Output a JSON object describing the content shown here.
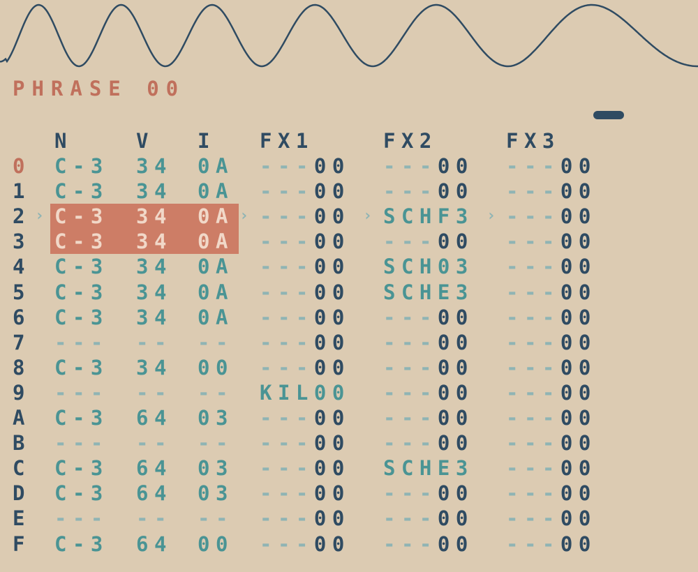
{
  "phrase": {
    "title": "PHRASE 00"
  },
  "columns": {
    "note": "N",
    "vel": "V",
    "inst": "I",
    "fx1": "FX1",
    "fx2": "FX2",
    "fx3": "FX3"
  },
  "colors": {
    "background": "#dccbb2",
    "accent": "#c0705c",
    "note": "#4a9494",
    "ink": "#2f4b62",
    "selection": "#cd7d66"
  },
  "rows": [
    {
      "num": "0",
      "note": "C-3",
      "vel": "34",
      "inst": "0A",
      "fx1": "---00",
      "fx2": "---00",
      "fx3": "---00"
    },
    {
      "num": "1",
      "note": "C-3",
      "vel": "34",
      "inst": "0A",
      "fx1": "---00",
      "fx2": "---00",
      "fx3": "---00"
    },
    {
      "num": "2",
      "note": "C-3",
      "vel": "34",
      "inst": "0A",
      "fx1": "---00",
      "fx2": "SCHF3",
      "fx3": "---00"
    },
    {
      "num": "3",
      "note": "C-3",
      "vel": "34",
      "inst": "0A",
      "fx1": "---00",
      "fx2": "---00",
      "fx3": "---00"
    },
    {
      "num": "4",
      "note": "C-3",
      "vel": "34",
      "inst": "0A",
      "fx1": "---00",
      "fx2": "SCH03",
      "fx3": "---00"
    },
    {
      "num": "5",
      "note": "C-3",
      "vel": "34",
      "inst": "0A",
      "fx1": "---00",
      "fx2": "SCHE3",
      "fx3": "---00"
    },
    {
      "num": "6",
      "note": "C-3",
      "vel": "34",
      "inst": "0A",
      "fx1": "---00",
      "fx2": "---00",
      "fx3": "---00"
    },
    {
      "num": "7",
      "note": "---",
      "vel": "--",
      "inst": "--",
      "fx1": "---00",
      "fx2": "---00",
      "fx3": "---00"
    },
    {
      "num": "8",
      "note": "C-3",
      "vel": "34",
      "inst": "00",
      "fx1": "---00",
      "fx2": "---00",
      "fx3": "---00"
    },
    {
      "num": "9",
      "note": "---",
      "vel": "--",
      "inst": "--",
      "fx1": "KIL00",
      "fx2": "---00",
      "fx3": "---00"
    },
    {
      "num": "A",
      "note": "C-3",
      "vel": "64",
      "inst": "03",
      "fx1": "---00",
      "fx2": "---00",
      "fx3": "---00"
    },
    {
      "num": "B",
      "note": "---",
      "vel": "--",
      "inst": "--",
      "fx1": "---00",
      "fx2": "---00",
      "fx3": "---00"
    },
    {
      "num": "C",
      "note": "C-3",
      "vel": "64",
      "inst": "03",
      "fx1": "---00",
      "fx2": "SCHE3",
      "fx3": "---00"
    },
    {
      "num": "D",
      "note": "C-3",
      "vel": "64",
      "inst": "03",
      "fx1": "---00",
      "fx2": "---00",
      "fx3": "---00"
    },
    {
      "num": "E",
      "note": "---",
      "vel": "--",
      "inst": "--",
      "fx1": "---00",
      "fx2": "---00",
      "fx3": "---00"
    },
    {
      "num": "F",
      "note": "C-3",
      "vel": "64",
      "inst": "00",
      "fx1": "---00",
      "fx2": "---00",
      "fx3": "---00"
    }
  ],
  "state": {
    "active_row": "0",
    "cursor_row": "2",
    "selected_rows": [
      "2",
      "3"
    ]
  }
}
